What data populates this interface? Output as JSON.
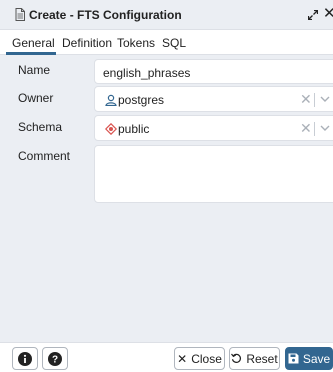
{
  "window": {
    "title": "Create - FTS Configuration"
  },
  "tabs": [
    {
      "label": "General",
      "active": true
    },
    {
      "label": "Definition",
      "active": false
    },
    {
      "label": "Tokens",
      "active": false
    },
    {
      "label": "SQL",
      "active": false
    }
  ],
  "form": {
    "name_label": "Name",
    "name_value": "english_phrases",
    "owner_label": "Owner",
    "owner_value": "postgres",
    "schema_label": "Schema",
    "schema_value": "public",
    "comment_label": "Comment",
    "comment_value": ""
  },
  "footer": {
    "info_icon": "info-icon",
    "help_icon": "help-icon",
    "close_label": "Close",
    "reset_label": "Reset",
    "save_label": "Save"
  },
  "colors": {
    "primary": "#326690",
    "panel_bg": "#ebeef3",
    "owner_icon": "#326690",
    "schema_icon": "#d9534f"
  }
}
